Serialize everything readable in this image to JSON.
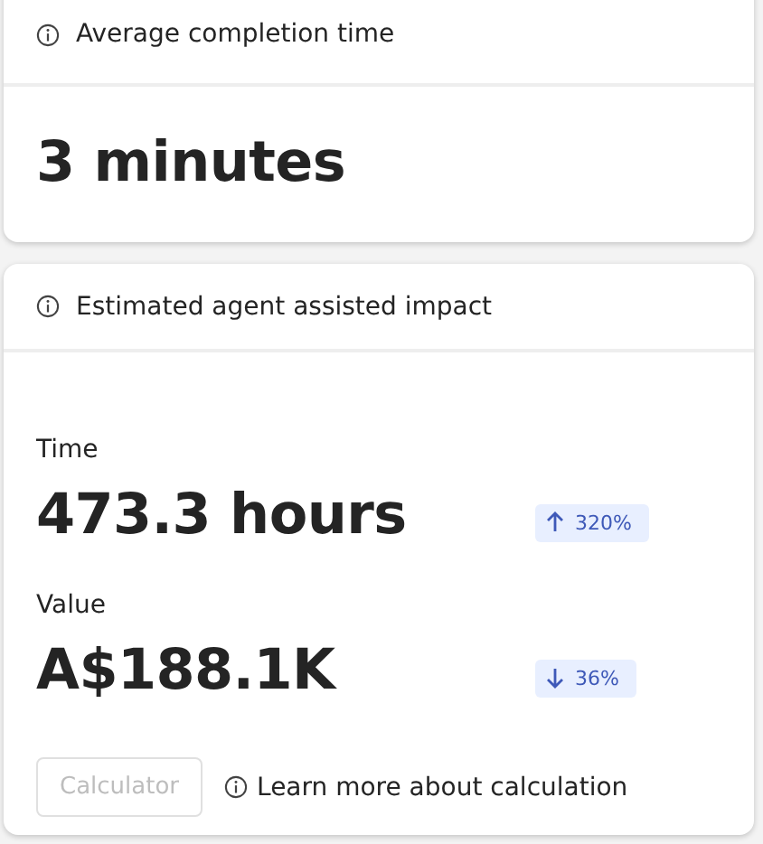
{
  "cards": [
    {
      "title": "Average completion time",
      "value": "3 minutes"
    },
    {
      "title": "Estimated agent assisted impact",
      "metrics": [
        {
          "label": "Time",
          "value": "473.3 hours",
          "change": {
            "kind": "up",
            "text": "320%"
          }
        },
        {
          "label": "Value",
          "value": "A$188.1K",
          "change": {
            "kind": "down",
            "text": "36%"
          }
        }
      ],
      "calculator": {
        "label": "Calculator",
        "disabled": true
      },
      "link": "Learn more about calculation"
    }
  ]
}
